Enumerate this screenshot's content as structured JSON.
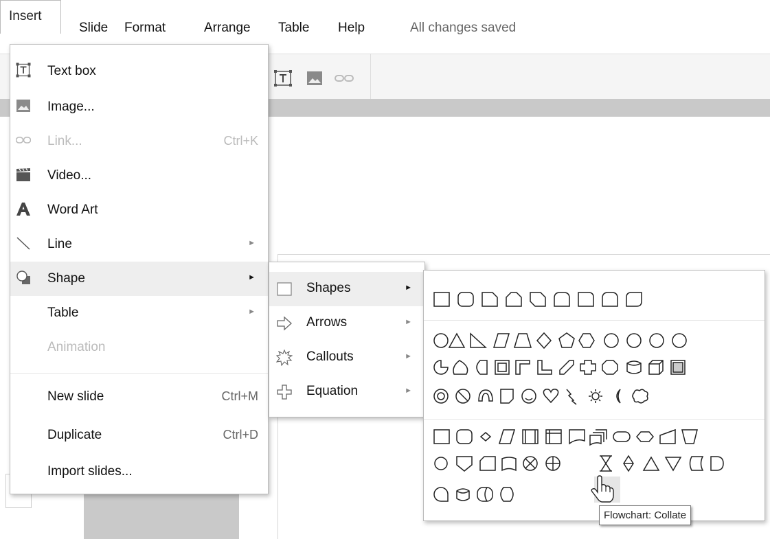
{
  "menubar": {
    "items": [
      "Insert",
      "Slide",
      "Format",
      "Arrange",
      "Table",
      "Help"
    ],
    "status": "All changes saved"
  },
  "insert_menu": {
    "items": [
      {
        "label": "Text box",
        "icon": "text-box-icon",
        "shortcut": "",
        "submenu": false,
        "disabled": false
      },
      {
        "label": "Image...",
        "icon": "image-icon",
        "shortcut": "",
        "submenu": false,
        "disabled": false
      },
      {
        "label": "Link...",
        "icon": "link-icon",
        "shortcut": "Ctrl+K",
        "submenu": false,
        "disabled": true
      },
      {
        "label": "Video...",
        "icon": "video-icon",
        "shortcut": "",
        "submenu": false,
        "disabled": false
      },
      {
        "label": "Word Art",
        "icon": "word-art-icon",
        "shortcut": "",
        "submenu": false,
        "disabled": false
      },
      {
        "label": "Line",
        "icon": "line-icon",
        "shortcut": "",
        "submenu": true,
        "disabled": false
      },
      {
        "label": "Shape",
        "icon": "shape-icon",
        "shortcut": "",
        "submenu": true,
        "disabled": false,
        "highlighted": true
      },
      {
        "label": "Table",
        "icon": "",
        "shortcut": "",
        "submenu": true,
        "disabled": false
      },
      {
        "label": "Animation",
        "icon": "",
        "shortcut": "",
        "submenu": false,
        "disabled": true
      },
      {
        "label": "New slide",
        "icon": "",
        "shortcut": "Ctrl+M",
        "submenu": false,
        "disabled": false
      },
      {
        "label": "Duplicate",
        "icon": "",
        "shortcut": "Ctrl+D",
        "submenu": false,
        "disabled": false
      },
      {
        "label": "Import slides...",
        "icon": "",
        "shortcut": "",
        "submenu": false,
        "disabled": false
      }
    ]
  },
  "shape_submenu": {
    "items": [
      {
        "label": "Shapes",
        "icon": "square-icon",
        "highlighted": true
      },
      {
        "label": "Arrows",
        "icon": "arrow-right-icon"
      },
      {
        "label": "Callouts",
        "icon": "callout-burst-icon"
      },
      {
        "label": "Equation",
        "icon": "plus-icon"
      }
    ]
  },
  "tooltip": "Flowchart: Collate",
  "colors": {
    "highlight": "#eeeeee",
    "menu_border": "#bbbbbb",
    "disabled": "#bbbbbb"
  }
}
